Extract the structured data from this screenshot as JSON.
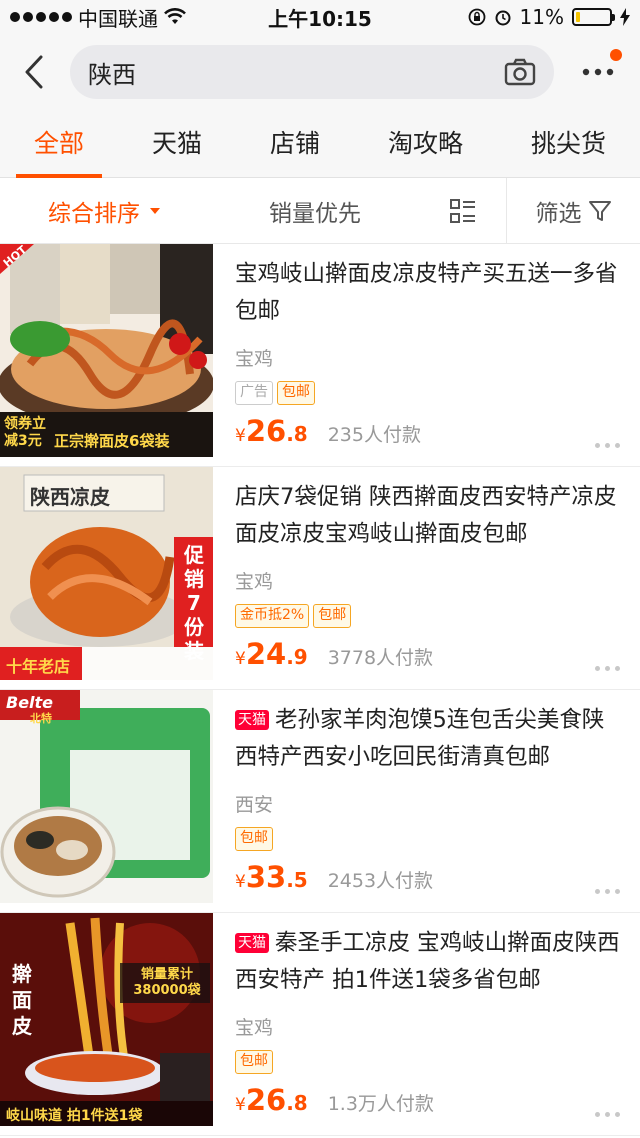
{
  "status": {
    "carrier": "中国联通",
    "time": "上午10:15",
    "battery": "11%"
  },
  "search": {
    "query": "陕西"
  },
  "tabs": [
    {
      "label": "全部",
      "active": true
    },
    {
      "label": "天猫"
    },
    {
      "label": "店铺"
    },
    {
      "label": "淘攻略"
    },
    {
      "label": "挑尖货"
    }
  ],
  "sort": {
    "main": "综合排序",
    "sales": "销量优先",
    "filter": "筛选"
  },
  "products": [
    {
      "title": "宝鸡岐山擀面皮凉皮特产买五送一多省包邮",
      "location": "宝鸡",
      "tmall": "",
      "tags": [
        "广告",
        "包邮"
      ],
      "price_int": "26",
      "price_dec": ".8",
      "sold": "235人付款",
      "img": {
        "bg": "#c44a1e",
        "accent": "#ffd84a",
        "line1": "领券立减3元",
        "line2": "正宗擀面皮6袋装",
        "badge": "HOT"
      }
    },
    {
      "title": "店庆7袋促销 陕西擀面皮西安特产凉皮面皮凉皮宝鸡岐山擀面皮包邮",
      "location": "宝鸡",
      "tmall": "",
      "tags": [
        "金币抵2%",
        "包邮"
      ],
      "price_int": "24",
      "price_dec": ".9",
      "sold": "3778人付款",
      "img": {
        "bg": "#e8e0cf",
        "accent": "#e02020",
        "line1": "陕西凉皮",
        "line2": "十年老店",
        "side": "促销7份装"
      }
    },
    {
      "title": "老孙家羊肉泡馍5连包舌尖美食陕西特产西安小吃回民街清真包邮",
      "location": "西安",
      "tmall": "天猫",
      "tags": [
        "包邮"
      ],
      "price_int": "33",
      "price_dec": ".5",
      "sold": "2453人付款",
      "img": {
        "bg": "#3fae5a",
        "accent": "#e23030",
        "line1": "Belte",
        "line2": "北特"
      }
    },
    {
      "title": "秦圣手工凉皮 宝鸡岐山擀面皮陕西西安特产 拍1件送1袋多省包邮",
      "location": "宝鸡",
      "tmall": "天猫",
      "tags": [
        "包邮"
      ],
      "price_int": "26",
      "price_dec": ".8",
      "sold": "1.3万人付款",
      "img": {
        "bg": "#7a1410",
        "accent": "#ffd84a",
        "line1": "擀面皮",
        "line2": "销量累计380000袋",
        "line3": "岐山味道 拍1件送1袋"
      }
    }
  ]
}
